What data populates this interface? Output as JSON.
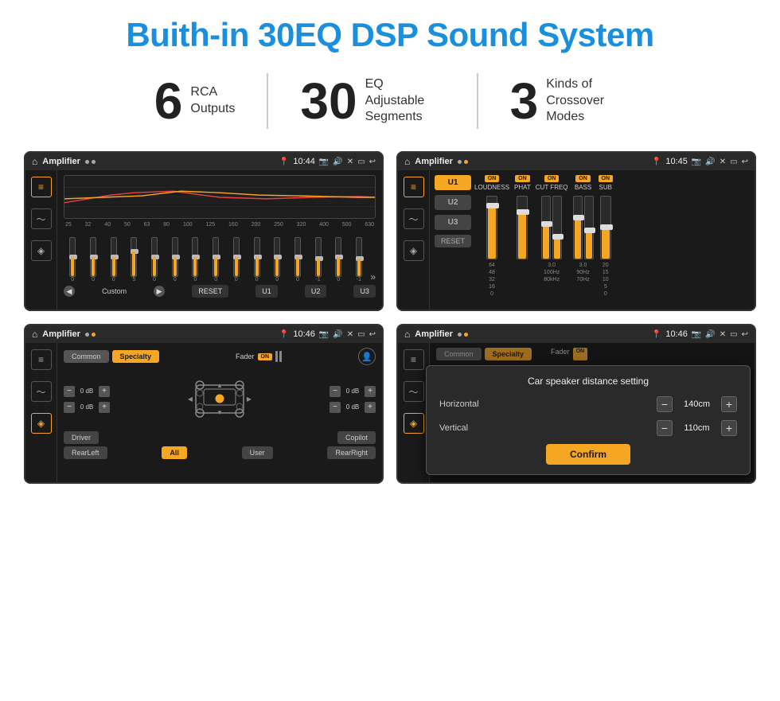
{
  "header": {
    "title": "Buith-in 30EQ DSP Sound System"
  },
  "stats": [
    {
      "number": "6",
      "label": "RCA\nOutputs"
    },
    {
      "number": "30",
      "label": "EQ Adjustable\nSegments"
    },
    {
      "number": "3",
      "label": "Kinds of\nCrossover Modes"
    }
  ],
  "screens": {
    "eq": {
      "topbar_title": "Amplifier",
      "time": "10:44",
      "freqs": [
        "25",
        "32",
        "40",
        "50",
        "63",
        "80",
        "100",
        "125",
        "160",
        "200",
        "250",
        "320",
        "400",
        "500",
        "630"
      ],
      "values": [
        "0",
        "0",
        "0",
        "5",
        "0",
        "0",
        "0",
        "0",
        "0",
        "0",
        "0",
        "0",
        "-1",
        "0",
        "-1"
      ],
      "nav_labels": [
        "Custom",
        "RESET",
        "U1",
        "U2",
        "U3"
      ]
    },
    "crossover": {
      "topbar_title": "Amplifier",
      "time": "10:45",
      "presets": [
        "U1",
        "U2",
        "U3"
      ],
      "channels": [
        "LOUDNESS",
        "PHAT",
        "CUT FREQ",
        "BASS",
        "SUB"
      ],
      "reset_label": "RESET"
    },
    "fader": {
      "topbar_title": "Amplifier",
      "time": "10:46",
      "tabs": [
        "Common",
        "Specialty"
      ],
      "fader_label": "Fader",
      "volumes": [
        "0 dB",
        "0 dB",
        "0 dB",
        "0 dB"
      ],
      "positions": [
        "Driver",
        "RearLeft",
        "All",
        "User",
        "RearRight",
        "Copilot"
      ]
    },
    "distance": {
      "topbar_title": "Amplifier",
      "time": "10:46",
      "dialog_title": "Car speaker distance setting",
      "horizontal_label": "Horizontal",
      "horizontal_value": "140cm",
      "vertical_label": "Vertical",
      "vertical_value": "110cm",
      "confirm_label": "Confirm"
    }
  },
  "colors": {
    "accent": "#f5a623",
    "brand_blue": "#1a8fdd",
    "screen_bg": "#1a1a1a",
    "topbar_bg": "#2a2a2a"
  }
}
